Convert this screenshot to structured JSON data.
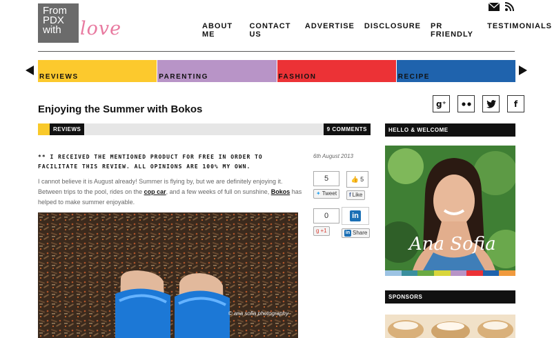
{
  "logo": {
    "box_lines": [
      "From",
      "PDX",
      "with"
    ],
    "script": "love"
  },
  "header_icons": [
    {
      "name": "mail-icon"
    },
    {
      "name": "rss-icon"
    }
  ],
  "nav": [
    "ABOUT ME",
    "CONTACT US",
    "ADVERTISE",
    "DISCLOSURE",
    "PR FRIENDLY",
    "TESTIMONIALS"
  ],
  "categories": [
    {
      "label": "REVIEWS",
      "color": "#fcc92d"
    },
    {
      "label": "PARENTING",
      "color": "#b894c7"
    },
    {
      "label": "FASHION",
      "color": "#ec3236"
    },
    {
      "label": "RECIPE",
      "color": "#1f63ad"
    }
  ],
  "post": {
    "title": "Enjoying the Summer with Bokos",
    "category": "REVIEWS",
    "comments": "9 COMMENTS",
    "date": "6th August 2013",
    "disclaimer": "** I RECEIVED THE MENTIONED PRODUCT FOR FREE IN ORDER TO FACILITATE THIS REVIEW. ALL OPINIONS ARE 100% MY OWN.",
    "body_1": "I cannot believe it is August already! Summer is flying by, but we are definitely enjoying it. Between trips to the pool, rides on the ",
    "link_1": "cop car",
    "body_2": ", and a few weeks of full on sunshine, ",
    "link_2": "Bokos",
    "body_3": " has helped to make summer enjoyable.",
    "photo_caption": "© ana sofia photography"
  },
  "social": [
    {
      "name": "google-plus-icon",
      "glyph": "g⁺"
    },
    {
      "name": "flickr-icon",
      "glyph": "●●"
    },
    {
      "name": "twitter-icon",
      "glyph": "🐦"
    },
    {
      "name": "facebook-icon",
      "glyph": "f"
    }
  ],
  "share": {
    "tweet_count": "5",
    "tweet_label": "Tweet",
    "like_count": "5",
    "like_label": "Like",
    "gplus_count": "0",
    "gplus_label": "+1",
    "linkedin_label": "Share"
  },
  "sidebar": {
    "welcome": "HELLO & WELCOME",
    "profile_name": "Ana Sofia",
    "sponsors": "SPONSORS",
    "stripe_colors": [
      "#9cc3e3",
      "#3a8f9e",
      "#6aaa42",
      "#d9d63b",
      "#b894c7",
      "#ec3236",
      "#1f63ad",
      "#f09a3e"
    ]
  }
}
